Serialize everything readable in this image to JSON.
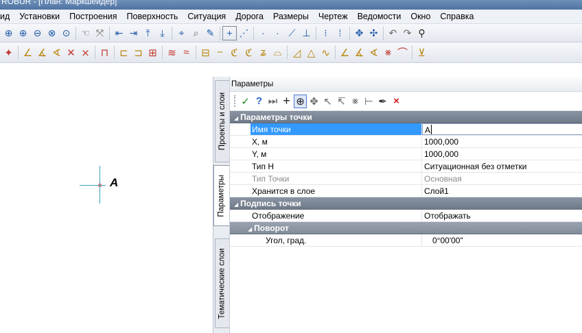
{
  "window": {
    "title": "ROBUR - [План: Маркшейдер]"
  },
  "menu": [
    "ид",
    "Установки",
    "Построения",
    "Поверхность",
    "Ситуация",
    "Дорога",
    "Размеры",
    "Чертеж",
    "Ведомости",
    "Окно",
    "Справка"
  ],
  "canvas": {
    "point_label": "A"
  },
  "side_tabs": {
    "projects": "Проекты и слои",
    "params": "Параметры",
    "thematic": "Тематические слои"
  },
  "panel": {
    "title": "Параметры",
    "categories": {
      "point_params": "Параметры точки",
      "point_caption": "Подпись точки",
      "rotation": "Поворот"
    },
    "rows": {
      "name": {
        "label": "Имя точки",
        "value": "A"
      },
      "x": {
        "label": "X, м",
        "value": "1000,000"
      },
      "y": {
        "label": "Y, м",
        "value": "1000,000"
      },
      "type_h": {
        "label": "Тип Н",
        "value": "Ситуационная без отметки"
      },
      "point_type": {
        "label": "Тип Точки",
        "value": "Основная"
      },
      "layer": {
        "label": "Хранится в слое",
        "value": "Слой1"
      },
      "display": {
        "label": "Отображение",
        "value": "Отображать"
      },
      "angle": {
        "label": "Угол, град.",
        "value": "0°00'00\""
      }
    }
  },
  "colors": {
    "selection": "#3399ff",
    "category_bg": "#7d8796",
    "accent": "#1f5aa8"
  }
}
